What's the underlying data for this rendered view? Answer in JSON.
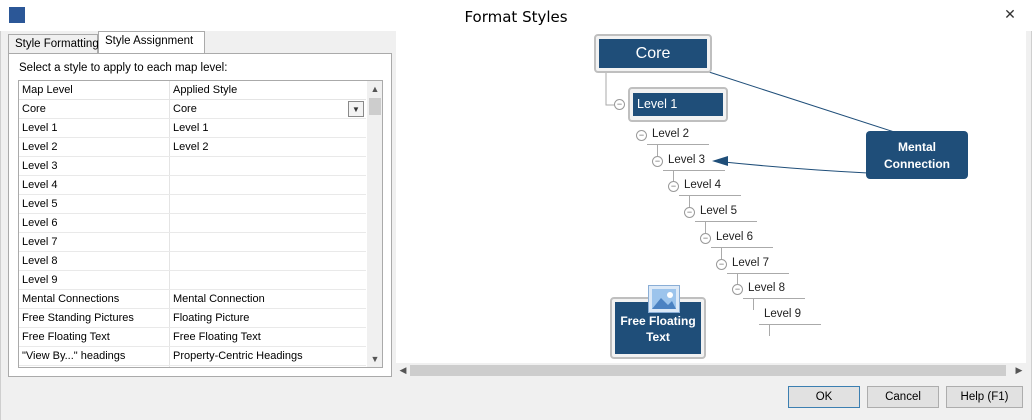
{
  "window": {
    "title": "Format Styles"
  },
  "tabs": [
    {
      "label": "Style Formatting"
    },
    {
      "label": "Style Assignment"
    }
  ],
  "assignment": {
    "instruction": "Select a style to apply to each map level:",
    "columns": [
      "Map Level",
      "Applied Style"
    ],
    "rows": [
      {
        "level": "Core",
        "style": "Core"
      },
      {
        "level": "Level 1",
        "style": "Level 1"
      },
      {
        "level": "Level 2",
        "style": "Level 2"
      },
      {
        "level": "Level 3",
        "style": ""
      },
      {
        "level": "Level 4",
        "style": ""
      },
      {
        "level": "Level 5",
        "style": ""
      },
      {
        "level": "Level 6",
        "style": ""
      },
      {
        "level": "Level 7",
        "style": ""
      },
      {
        "level": "Level 8",
        "style": ""
      },
      {
        "level": "Level 9",
        "style": ""
      },
      {
        "level": "Mental Connections",
        "style": "Mental Connection"
      },
      {
        "level": "Free Standing Pictures",
        "style": "Floating Picture"
      },
      {
        "level": "Free Floating Text",
        "style": "Free Floating Text"
      },
      {
        "level": "\"View By...\" headings",
        "style": "Property-Centric Headings"
      }
    ]
  },
  "preview": {
    "core": "Core",
    "level1": "Level 1",
    "sublevels": [
      "Level 2",
      "Level 3",
      "Level 4",
      "Level 5",
      "Level 6",
      "Level 7",
      "Level 8",
      "Level 9"
    ],
    "connection": "Mental Connection",
    "free_text": "Free Floating Text",
    "accent": "#1f4e79"
  },
  "buttons": {
    "ok": "OK",
    "cancel": "Cancel",
    "help": "Help (F1)"
  }
}
